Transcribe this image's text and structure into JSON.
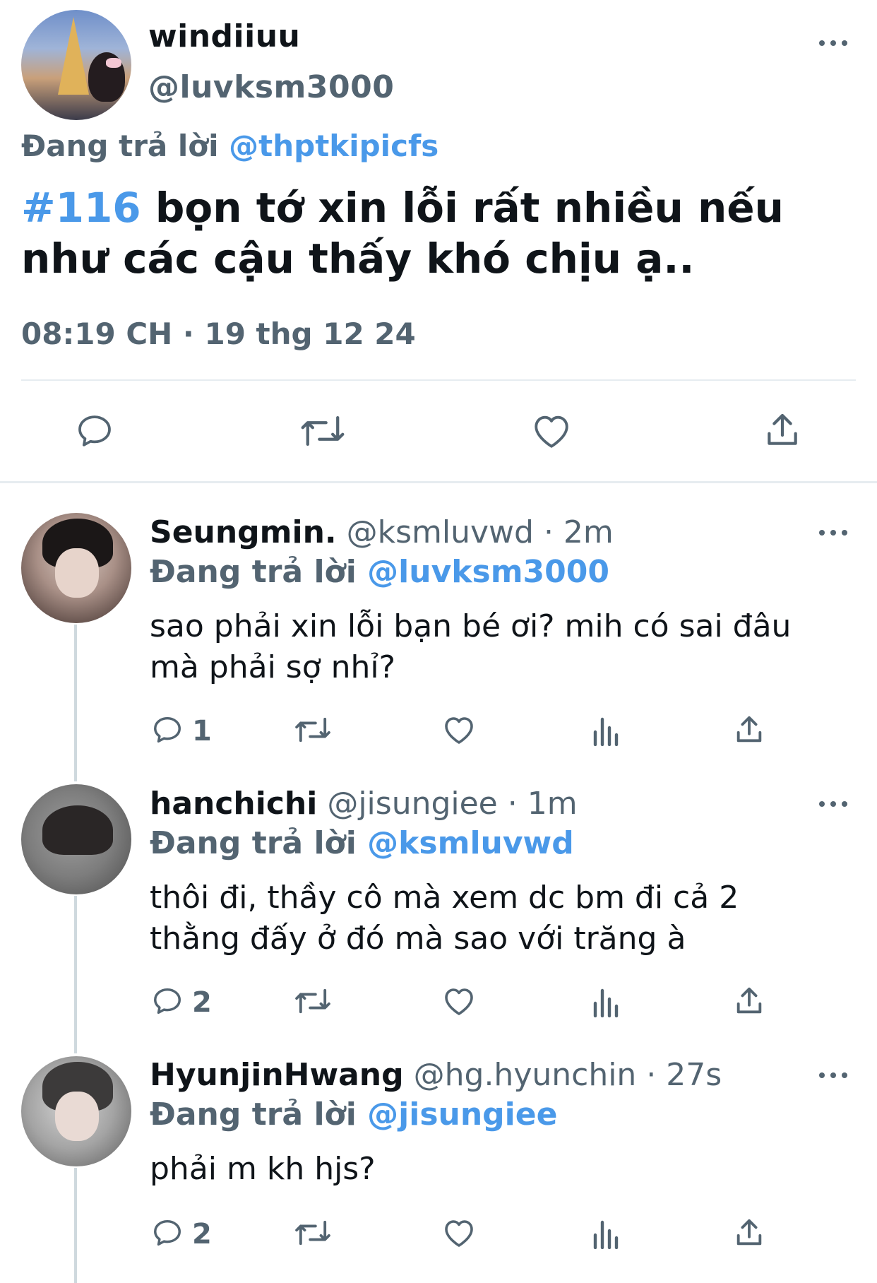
{
  "main_tweet": {
    "display_name": "windiiuu",
    "handle": "@luvksm3000",
    "replying_prefix": "Đang trả lời",
    "replying_to": "@thptkipicfs",
    "hashtag": "#116",
    "text": " bọn tớ xin lỗi rất nhiều nếu như các cậu thấy khó chịu ạ..",
    "timestamp": "08:19 CH · 19 thg 12 24"
  },
  "replies": [
    {
      "display_name": "Seungmin.",
      "handle_time": " @ksmluvwd · 2m",
      "replying_prefix": "Đang trả lời",
      "replying_to": "@luvksm3000",
      "text": "sao phải xin lỗi bạn bé ơi? mih có sai đâu mà phải sợ nhỉ?",
      "reply_count": "1"
    },
    {
      "display_name": "hanchichi",
      "handle_time": " @jisungiee · 1m",
      "replying_prefix": "Đang trả lời",
      "replying_to": "@ksmluvwd",
      "text": "thôi đi, thầy cô mà xem dc bm đi cả 2 thằng đấy ở đó mà sao với trăng à",
      "reply_count": "2"
    },
    {
      "display_name": "HyunjinHwang",
      "handle_time": " @hg.hyunchin · 27s",
      "replying_prefix": "Đang trả lời",
      "replying_to": "@jisungiee",
      "text": "phải m kh hjs?",
      "reply_count": "2"
    }
  ],
  "icons": {
    "reply": "reply-icon",
    "retweet": "retweet-icon",
    "like": "like-icon",
    "views": "views-icon",
    "share": "share-icon",
    "more": "more-icon"
  },
  "colors": {
    "accent": "#4a99e9",
    "secondary_text": "#536471",
    "divider": "#e6ecf0"
  }
}
